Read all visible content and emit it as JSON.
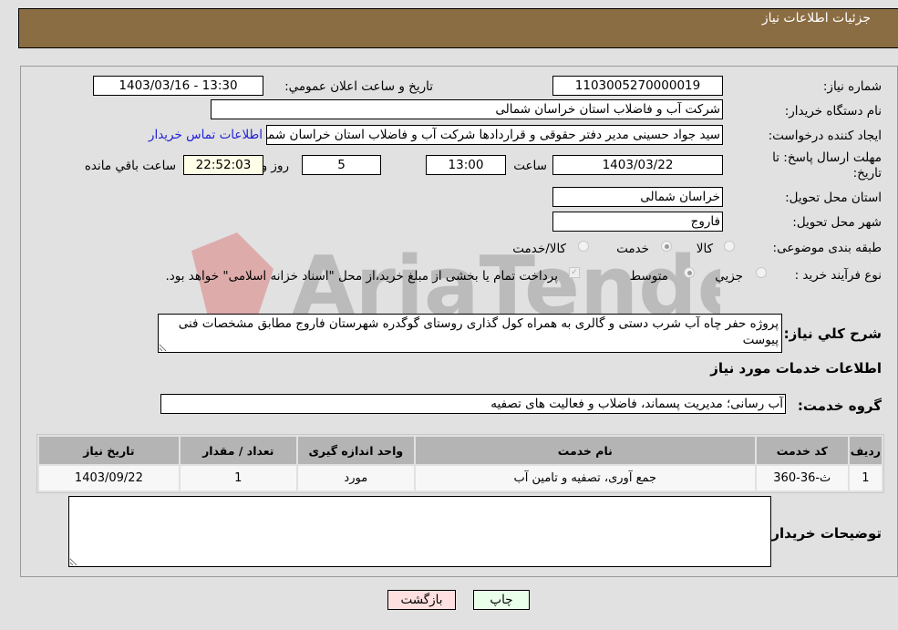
{
  "header": {
    "title": "جزئيات اطلاعات نياز"
  },
  "fields": {
    "need_number": {
      "label": "شماره نياز:",
      "value": "1103005270000019"
    },
    "announce_datetime": {
      "label": "تاريخ و ساعت اعلان عمومي:",
      "value": "1403/03/16 - 13:30"
    },
    "buyer_org": {
      "label": "نام دستگاه خريدار:",
      "value": "شرکت آب و فاضلاب استان خراسان شمالی"
    },
    "requester": {
      "label": "ايجاد کننده درخواست:",
      "value": "سید جواد حسینی مدیر دفتر حقوقی و قراردادها  شرکت آب و فاضلاب استان خراسان شمالی"
    },
    "buyer_contact_link": "اطلاعات تماس خريدار",
    "deadline": {
      "label_line1": "مهلت ارسال پاسخ: تا",
      "label_line2": "تاريخ:",
      "date": "1403/03/22",
      "time_label": "ساعت",
      "time": "13:00",
      "days": "5",
      "days_label": "روز و",
      "remaining": "22:52:03",
      "remaining_label": "ساعت باقي مانده"
    },
    "delivery_province": {
      "label": "استان محل تحويل:",
      "value": "خراسان شمالی"
    },
    "delivery_city": {
      "label": "شهر محل تحويل:",
      "value": "فاروج"
    },
    "category": {
      "label": "طبقه بندی موضوعی:",
      "options": [
        "کالا",
        "خدمت",
        "کالا/خدمت"
      ],
      "selected": "خدمت"
    },
    "purchase_type": {
      "label": "نوع فرآيند خريد :",
      "options": [
        "جزيي",
        "متوسط"
      ],
      "selected": "متوسط",
      "treasury_note": "پرداخت تمام يا بخشی از مبلغ خريد،از محل \"اسناد خزانه اسلامی\" خواهد بود.",
      "treasury_checked": true
    }
  },
  "description": {
    "label": "شرح کلي نياز:",
    "value": "پروژه حفر چاه آب شرب دستی و گالری به همراه کول گذاری روستای گوگدره شهرستان فاروج مطابق مشخصات فنی پیوست"
  },
  "services_section": {
    "title": "اطلاعات خدمات مورد نياز",
    "group_label": "گروه خدمت:",
    "group_value": "آب رسانی؛ مدیریت پسماند، فاضلاب و فعالیت های تصفیه"
  },
  "table": {
    "headers": [
      "رديف",
      "کد خدمت",
      "نام خدمت",
      "واحد اندازه گيری",
      "تعداد / مقدار",
      "تاريخ نياز"
    ],
    "rows": [
      [
        "1",
        "ث-36-360",
        "جمع آوری، تصفیه و تامین آب",
        "مورد",
        "1",
        "1403/09/22"
      ]
    ]
  },
  "buyer_notes": {
    "label": "توضيحات خريدار:",
    "value": ""
  },
  "buttons": {
    "print": "چاپ",
    "back": "بازگشت"
  },
  "watermark": {
    "text": "AriaTender.neT"
  },
  "colors": {
    "header_bg": "#8b6d43",
    "print_bg": "#eaffea",
    "back_bg": "#ffe0e0",
    "remaining_bg": "#ffffe8",
    "link": "#1f1fd6"
  }
}
